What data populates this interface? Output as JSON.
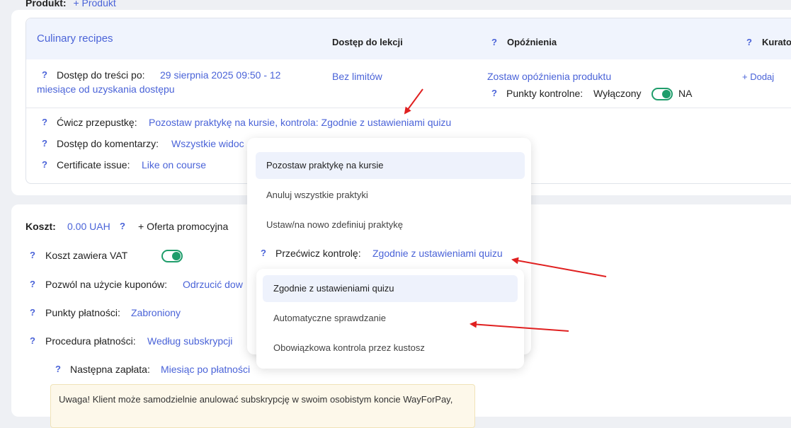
{
  "product": {
    "label": "Produkt:",
    "add_link": "+ Produkt"
  },
  "access": {
    "course_title": "Culinary recipes",
    "col_access": "Dostęp do lekcji",
    "col_delays": "Opóźnienia",
    "col_curator": "Kurato",
    "content_access_label": "Dostęp do treści po:",
    "content_access_value_line1": "29 sierpnia 2025 09:50  -  12",
    "content_access_value_line2": "miesiące od uzyskania dostępu",
    "lesson_access_value": "Bez limitów",
    "delay_value": "Zostaw opóźnienia produktu",
    "checkpoints_label": "Punkty kontrolne:",
    "checkpoints_value": "Wyłączony",
    "checkpoints_na": "NA",
    "curator_add": "+ Dodaj",
    "practice_label": "Ćwicz przepustkę:",
    "practice_value": "Pozostaw praktykę na kursie, kontrola: Zgodnie z ustawieniami quizu",
    "comments_label": "Dostęp do komentarzy:",
    "comments_value": "Wszystkie widoc",
    "certificate_label": "Certificate issue:",
    "certificate_value": "Like on course"
  },
  "cost": {
    "label": "Koszt:",
    "value": "0.00 UAH",
    "promo": "+ Oferta promocyjna",
    "vat_label": "Koszt zawiera VAT",
    "coupons_label": "Pozwól na użycie kuponów:",
    "coupons_value": "Odrzucić dow",
    "payment_points_label": "Punkty płatności:",
    "payment_points_value": "Zabroniony",
    "procedure_label": "Procedura płatności:",
    "procedure_value": "Według subskrypcji",
    "next_payment_label": "Następna zapłata:",
    "next_payment_value": "Miesiąc po płatności",
    "warning_text": "Uwaga! Klient może samodzielnie anulować subskrypcję w swoim osobistym koncie WayForPay,"
  },
  "dropdown": {
    "options": [
      "Pozostaw praktykę na kursie",
      "Anuluj wszystkie praktyki",
      "Ustaw/na nowo zdefiniuj praktykę"
    ],
    "control_label": "Przećwicz kontrolę:",
    "control_value": "Zgodnie z ustawieniami quizu",
    "control_options": [
      "Zgodnie z ustawieniami quizu",
      "Automatyczne sprawdzanie",
      "Obowiązkowa kontrola przez kustosz"
    ]
  },
  "q_mark": "?",
  "colors": {
    "link": "#4a63d8",
    "toggle": "#1f9d6b",
    "arrow": "#e02020"
  }
}
